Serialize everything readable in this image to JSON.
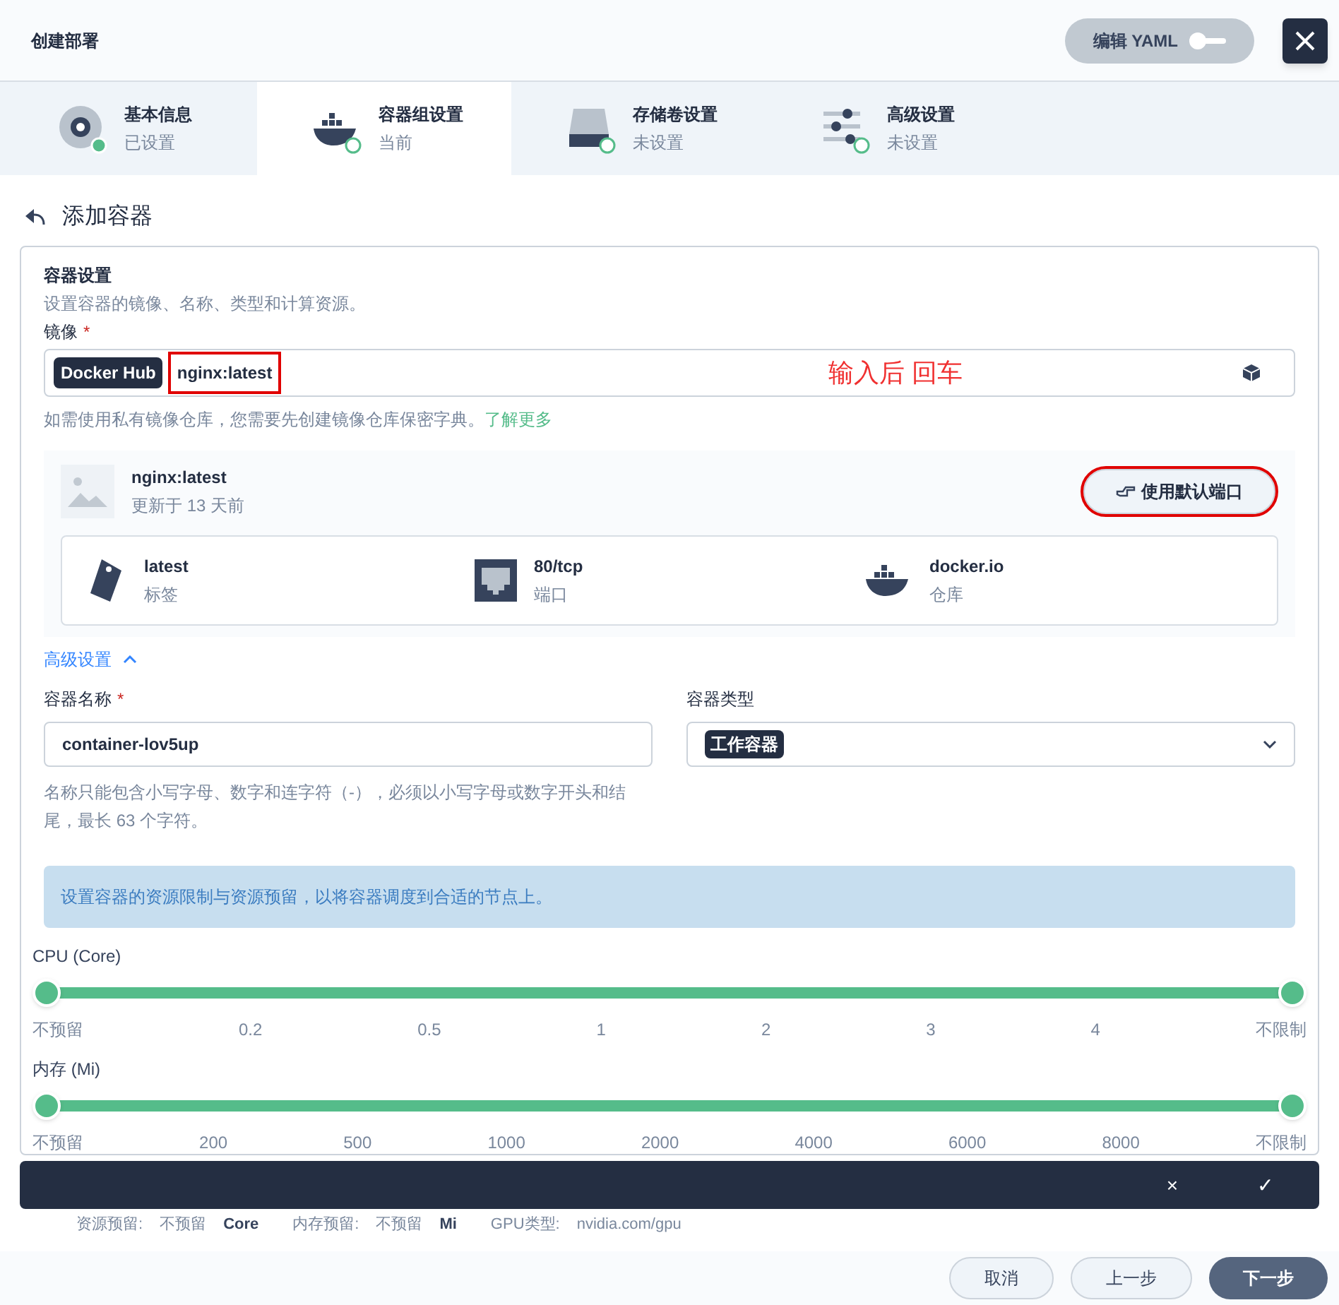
{
  "window": {
    "title": "创建部署"
  },
  "yaml_toggle": {
    "label": "编辑 YAML",
    "on": false
  },
  "steps": [
    {
      "title": "基本信息",
      "status": "已设置",
      "kind": "info",
      "done": true,
      "selected": false
    },
    {
      "title": "容器组设置",
      "status": "当前",
      "kind": "docker",
      "done": false,
      "selected": true
    },
    {
      "title": "存储卷设置",
      "status": "未设置",
      "kind": "disk",
      "done": false,
      "selected": false
    },
    {
      "title": "高级设置",
      "status": "未设置",
      "kind": "sliders",
      "done": false,
      "selected": false
    }
  ],
  "page_title": "添加容器",
  "section": {
    "title": "容器设置",
    "description": "设置容器的镜像、名称、类型和计算资源。"
  },
  "image": {
    "label": "镜像",
    "required_mark": "*",
    "registry": "Docker Hub",
    "value": "nginx:latest",
    "annotation": "输入后 回车",
    "hint": "如需使用私有镜像仓库，您需要先创建镜像仓库保密字典。",
    "hint_link": "了解更多"
  },
  "image_card": {
    "name": "nginx:latest",
    "updated": "更新于 13 天前",
    "button": "使用默认端口",
    "facts": [
      {
        "kind": "tag",
        "value": "latest",
        "label": "标签"
      },
      {
        "kind": "port",
        "value": "80/tcp",
        "label": "端口"
      },
      {
        "kind": "registry",
        "value": "docker.io",
        "label": "仓库"
      }
    ]
  },
  "advanced_toggle": {
    "label": "高级设置",
    "expanded": true
  },
  "name_field": {
    "label": "容器名称",
    "required_mark": "*",
    "value": "container-lov5up",
    "hint": "名称只能包含小写字母、数字和连字符（-），必须以小写字母或数字开头和结尾，最长 63 个字符。"
  },
  "type_field": {
    "label": "容器类型",
    "value": "工作容器"
  },
  "info_banner": "设置容器的资源限制与资源预留，以将容器调度到合适的节点上。",
  "sliders": [
    {
      "label": "CPU (Core)",
      "level": 1,
      "ticks": [
        "不预留",
        "0.2",
        "0.5",
        "1",
        "2",
        "3",
        "4",
        "不限制"
      ]
    },
    {
      "label": "内存 (Mi)",
      "level": 1,
      "ticks": [
        "不预留",
        "200",
        "500",
        "1000",
        "2000",
        "4000",
        "6000",
        "8000",
        "不限制"
      ]
    }
  ],
  "confirm_bar": {
    "cancel": "×",
    "confirm": "✓"
  },
  "reservations": [
    {
      "label": "资源预留:",
      "value": "不预留",
      "unit": "Core"
    },
    {
      "label": "内存预留:",
      "value": "不预留",
      "unit": "Mi"
    },
    {
      "label": "GPU类型:",
      "value": "nvidia.com/gpu"
    }
  ],
  "footer": {
    "buttons": [
      "取消",
      "上一步",
      "下一步"
    ]
  }
}
